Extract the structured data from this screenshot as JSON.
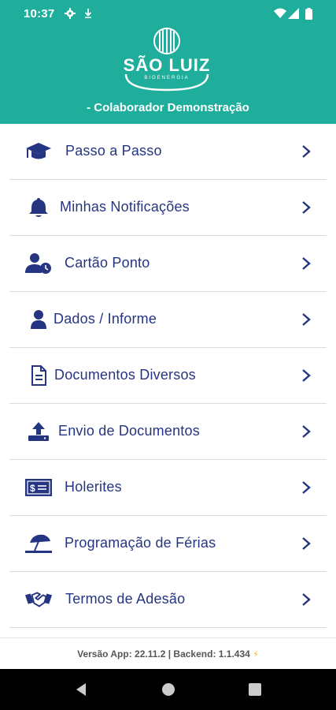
{
  "status_bar": {
    "time": "10:37",
    "icons": [
      "gear-icon",
      "download-arrow-icon",
      "wifi-icon",
      "signal-icon",
      "battery-icon"
    ]
  },
  "header": {
    "logo_text": "SÃO LUIZ",
    "logo_subtext": "BIOENERGIA",
    "user_label": "- Colaborador Demonstração",
    "background_color": "#1fae9c"
  },
  "menu": {
    "text_color": "#253582",
    "items": [
      {
        "label": "Passo a Passo",
        "icon": "graduation-cap-icon"
      },
      {
        "label": "Minhas Notificações",
        "icon": "bell-icon"
      },
      {
        "label": "Cartão Ponto",
        "icon": "user-clock-icon"
      },
      {
        "label": "Dados / Informe",
        "icon": "user-icon"
      },
      {
        "label": "Documentos Diversos",
        "icon": "document-icon"
      },
      {
        "label": "Envio de Documentos",
        "icon": "upload-icon"
      },
      {
        "label": "Holerites",
        "icon": "money-bill-icon"
      },
      {
        "label": "Programação de Férias",
        "icon": "beach-umbrella-icon"
      },
      {
        "label": "Termos de Adesão",
        "icon": "handshake-icon"
      }
    ]
  },
  "footer": {
    "version_text": "Versão App: 22.11.2 | Backend: 1.1.434",
    "accent_icon": "lightning-icon"
  },
  "nav_bar": {
    "buttons": [
      "back-button",
      "home-button",
      "recents-button"
    ]
  }
}
